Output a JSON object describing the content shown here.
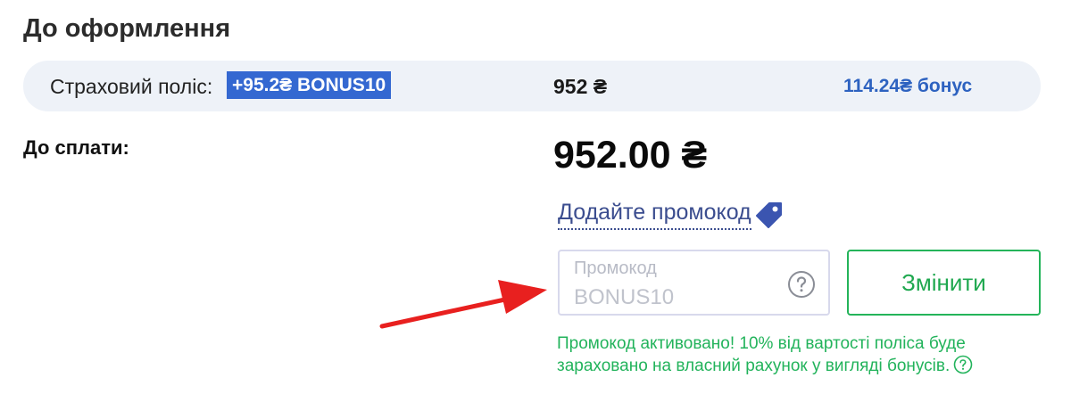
{
  "checkout": {
    "title": "До оформлення",
    "summary": {
      "label": "Страховий поліс:",
      "badge": "+95.2₴ BONUS10",
      "price": "952 ₴",
      "bonus": "114.24₴ бонус"
    },
    "pay_label": "До сплати:",
    "pay_amount": "952.00 ₴",
    "promo": {
      "link_label": "Додайте промокод",
      "field_label": "Промокод",
      "field_value": "BONUS10",
      "button_label": "Змінити",
      "success_message": "Промокод активовано! 10% від вартості поліса буде зараховано на власний рахунок у вигляді бонусів."
    }
  },
  "colors": {
    "accent_blue": "#3468d1",
    "bonus_text": "#2d62c0",
    "link": "#3b4d8f",
    "success_green": "#22b35b",
    "summary_bg": "#eef2f8",
    "annotation_arrow": "#e8201f"
  },
  "icons": {
    "promo_tag": "tag-icon",
    "field_help": "question-circle-icon",
    "message_help": "question-circle-icon",
    "annotation": "red-arrow"
  }
}
